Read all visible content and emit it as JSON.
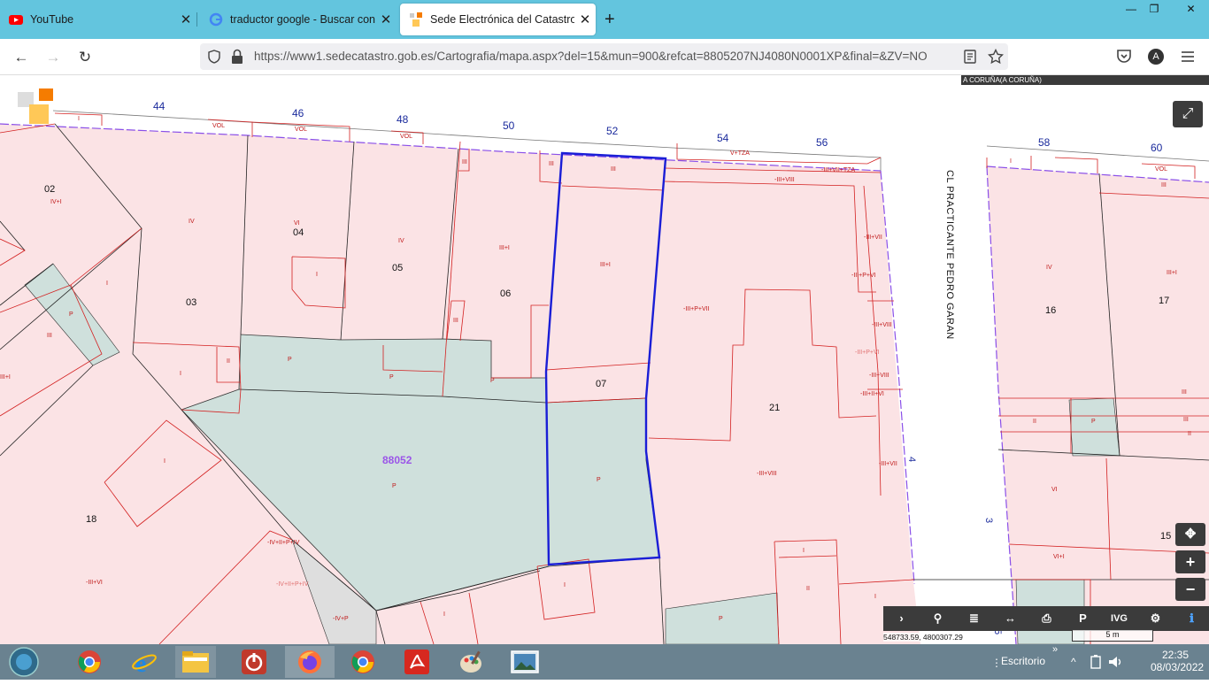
{
  "browser": {
    "tabs": [
      {
        "label": "YouTube",
        "active": false,
        "icon": "youtube-icon"
      },
      {
        "label": "traductor google - Buscar con G",
        "active": false,
        "icon": "google-icon"
      },
      {
        "label": "Sede Electrónica del Catastro - N",
        "active": true,
        "icon": "catastro-icon"
      }
    ],
    "close_glyph": "✕",
    "new_tab_glyph": "+",
    "url": "https://www1.sedecatastro.gob.es/Cartografia/mapa.aspx?del=15&mun=900&refcat=8805207NJ4080N0001XP&final=&ZV=NO",
    "account_initial": "A",
    "window_controls": [
      "—",
      "❐",
      "✕"
    ]
  },
  "map": {
    "region_label": "A CORUÑA(A CORUÑA)",
    "street_name": "CL PRACTICANTE PEDRO GARAN",
    "block_number": "88052",
    "street_numbers": [
      "44",
      "46",
      "48",
      "50",
      "52",
      "54",
      "56",
      "58",
      "60"
    ],
    "side_numbers": [
      "4",
      "3",
      "5"
    ],
    "parcel_numbers": [
      "02",
      "03",
      "04",
      "05",
      "06",
      "07",
      "21",
      "18",
      "16",
      "17",
      "15"
    ],
    "floor_labels": [
      "IV+I",
      "IV",
      "VI",
      "IV",
      "III+I",
      "III+I",
      "III",
      "III",
      "III",
      "III",
      "VOL",
      "VOL",
      "VOL",
      "I",
      "V+TZA",
      "-III+VIII",
      "-III+VII+TZA",
      "-III+P+VII",
      "-III+VII",
      "-III+P+VI",
      "-III+VIII",
      "-III+P+VI",
      "-III+VIII",
      "-III+II+VI",
      "-III+VII",
      "-III+VIII",
      "I",
      "P",
      "III",
      "II",
      "I",
      "P",
      "P",
      "P",
      "P",
      "P",
      "I",
      "I",
      "-IV+II+P+IV",
      "-III+VI",
      "-IV+II+P+IV",
      "-IV+P",
      "I",
      "I",
      "I",
      "II",
      "P",
      "I",
      "IV",
      "III+I",
      "II",
      "P",
      "III",
      "III",
      "VI",
      "VI+I",
      "II",
      "VOL",
      "I",
      "III",
      "II",
      "III+I"
    ],
    "coordinates": "548733.59, 4800307.29",
    "scale": "5 m",
    "toolbar": [
      "›",
      "⚲",
      "≣",
      "↔",
      "⎙",
      "P",
      "IVG",
      "⚙",
      "ℹ"
    ],
    "zoom_in": "+",
    "zoom_out": "−",
    "locate": "✥",
    "fullscreen": "⤢"
  },
  "taskbar": {
    "desktop_label": "Escritorio",
    "time": "22:35",
    "date": "08/03/2022",
    "chevron": "»",
    "tray_arrow": "^"
  }
}
